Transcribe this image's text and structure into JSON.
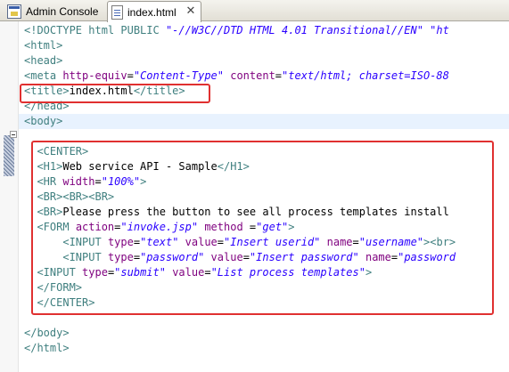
{
  "tabs": [
    {
      "label": "Admin Console",
      "icon": "admin-console-icon",
      "active": false
    },
    {
      "label": "index.html",
      "icon": "html-file-icon",
      "active": true,
      "close": "✕"
    }
  ],
  "colors": {
    "tag": "#3f7f7f",
    "attribute": "#7f007f",
    "value": "#2a00ff",
    "highlight_box": "#e03030",
    "current_line": "#e8f2fe"
  },
  "code_lines": [
    {
      "indent": "",
      "tokens": [
        {
          "t": "<!DOCTYPE html PUBLIC ",
          "c": "tg"
        },
        {
          "t": "\"-//W3C//DTD HTML 4.01 Transitional//EN\"",
          "c": "av"
        },
        {
          "t": " \"ht",
          "c": "av"
        }
      ]
    },
    {
      "indent": "",
      "tokens": [
        {
          "t": "<html>",
          "c": "tg"
        }
      ]
    },
    {
      "indent": "",
      "tokens": [
        {
          "t": "<head>",
          "c": "tg"
        }
      ]
    },
    {
      "indent": "",
      "tokens": [
        {
          "t": "<meta ",
          "c": "tg"
        },
        {
          "t": "http-equiv",
          "c": "at"
        },
        {
          "t": "=",
          "c": "tx"
        },
        {
          "t": "\"Content-Type\"",
          "c": "av"
        },
        {
          "t": " content",
          "c": "at"
        },
        {
          "t": "=",
          "c": "tx"
        },
        {
          "t": "\"text/html; charset=ISO-88",
          "c": "av"
        }
      ]
    },
    {
      "indent": "",
      "tokens": [
        {
          "t": "<title>",
          "c": "tg"
        },
        {
          "t": "index.html",
          "c": "tx"
        },
        {
          "t": "</title>",
          "c": "tg"
        }
      ]
    },
    {
      "indent": "",
      "tokens": [
        {
          "t": "</head>",
          "c": "tg"
        }
      ]
    },
    {
      "indent": "",
      "tokens": [
        {
          "t": "<body>",
          "c": "tg"
        }
      ]
    },
    {
      "indent": "",
      "tokens": []
    },
    {
      "indent": "  ",
      "tokens": [
        {
          "t": "<CENTER>",
          "c": "tg"
        }
      ]
    },
    {
      "indent": "  ",
      "tokens": [
        {
          "t": "<H1>",
          "c": "tg"
        },
        {
          "t": "Web service API - Sample",
          "c": "tx"
        },
        {
          "t": "</H1>",
          "c": "tg"
        }
      ]
    },
    {
      "indent": "  ",
      "tokens": [
        {
          "t": "<HR ",
          "c": "tg"
        },
        {
          "t": "width",
          "c": "at"
        },
        {
          "t": "=",
          "c": "tx"
        },
        {
          "t": "\"100%\"",
          "c": "av"
        },
        {
          "t": ">",
          "c": "tg"
        }
      ]
    },
    {
      "indent": "  ",
      "tokens": [
        {
          "t": "<BR><BR><BR>",
          "c": "tg"
        }
      ]
    },
    {
      "indent": "  ",
      "tokens": [
        {
          "t": "<BR>",
          "c": "tg"
        },
        {
          "t": "Please press the button to see all process templates install",
          "c": "tx"
        }
      ]
    },
    {
      "indent": "  ",
      "tokens": [
        {
          "t": "<FORM ",
          "c": "tg"
        },
        {
          "t": "action",
          "c": "at"
        },
        {
          "t": "=",
          "c": "tx"
        },
        {
          "t": "\"invoke.jsp\"",
          "c": "av"
        },
        {
          "t": " method ",
          "c": "at"
        },
        {
          "t": "=",
          "c": "tx"
        },
        {
          "t": "\"get\"",
          "c": "av"
        },
        {
          "t": ">",
          "c": "tg"
        }
      ]
    },
    {
      "indent": "      ",
      "tokens": [
        {
          "t": "<INPUT ",
          "c": "tg"
        },
        {
          "t": "type",
          "c": "at"
        },
        {
          "t": "=",
          "c": "tx"
        },
        {
          "t": "\"text\"",
          "c": "av"
        },
        {
          "t": " value",
          "c": "at"
        },
        {
          "t": "=",
          "c": "tx"
        },
        {
          "t": "\"Insert userid\"",
          "c": "av"
        },
        {
          "t": " name",
          "c": "at"
        },
        {
          "t": "=",
          "c": "tx"
        },
        {
          "t": "\"username\"",
          "c": "av"
        },
        {
          "t": "><br>",
          "c": "tg"
        }
      ]
    },
    {
      "indent": "      ",
      "tokens": [
        {
          "t": "<INPUT ",
          "c": "tg"
        },
        {
          "t": "type",
          "c": "at"
        },
        {
          "t": "=",
          "c": "tx"
        },
        {
          "t": "\"password\"",
          "c": "av"
        },
        {
          "t": " value",
          "c": "at"
        },
        {
          "t": "=",
          "c": "tx"
        },
        {
          "t": "\"Insert password\"",
          "c": "av"
        },
        {
          "t": " name",
          "c": "at"
        },
        {
          "t": "=",
          "c": "tx"
        },
        {
          "t": "\"password",
          "c": "av"
        }
      ]
    },
    {
      "indent": "  ",
      "tokens": [
        {
          "t": "<INPUT ",
          "c": "tg"
        },
        {
          "t": "type",
          "c": "at"
        },
        {
          "t": "=",
          "c": "tx"
        },
        {
          "t": "\"submit\"",
          "c": "av"
        },
        {
          "t": " value",
          "c": "at"
        },
        {
          "t": "=",
          "c": "tx"
        },
        {
          "t": "\"List process templates\"",
          "c": "av"
        },
        {
          "t": ">",
          "c": "tg"
        }
      ]
    },
    {
      "indent": "  ",
      "tokens": [
        {
          "t": "</FORM>",
          "c": "tg"
        }
      ]
    },
    {
      "indent": "  ",
      "tokens": [
        {
          "t": "</CENTER>",
          "c": "tg"
        }
      ]
    },
    {
      "indent": "",
      "tokens": []
    },
    {
      "indent": "",
      "tokens": [
        {
          "t": "</body>",
          "c": "tg"
        }
      ]
    },
    {
      "indent": "",
      "tokens": [
        {
          "t": "</html>",
          "c": "tg"
        }
      ]
    }
  ]
}
